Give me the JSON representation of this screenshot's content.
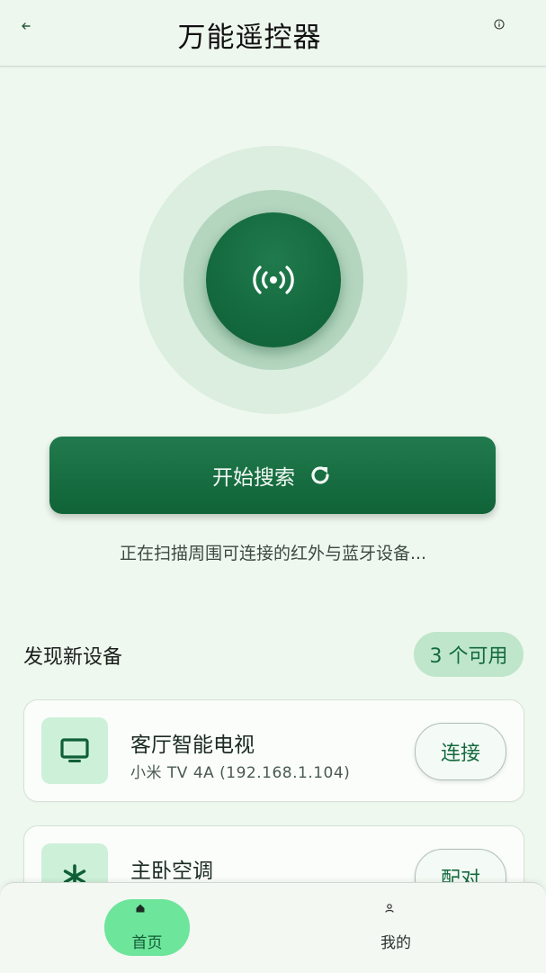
{
  "app": {
    "title": "万能遥控器"
  },
  "scan": {
    "button_label": "开始搜索",
    "status_text": "正在扫描周围可连接的红外与蓝牙设备..."
  },
  "section": {
    "title": "发现新设备",
    "count_badge": "3 个可用"
  },
  "devices": [
    {
      "name": "客厅智能电视",
      "detail": "小米 TV 4A (192.168.1.104)",
      "action": "连接",
      "icon": "tv-icon"
    },
    {
      "name": "主卧空调",
      "detail": "",
      "action": "配对",
      "icon": "snowflake-icon"
    }
  ],
  "nav": {
    "items": [
      {
        "label": "首页",
        "icon": "home-icon",
        "active": true
      },
      {
        "label": "我的",
        "icon": "person-icon",
        "active": false
      }
    ]
  },
  "colors": {
    "primary": "#146a3e",
    "accent": "#6de59b",
    "background": "#eff8ef"
  }
}
